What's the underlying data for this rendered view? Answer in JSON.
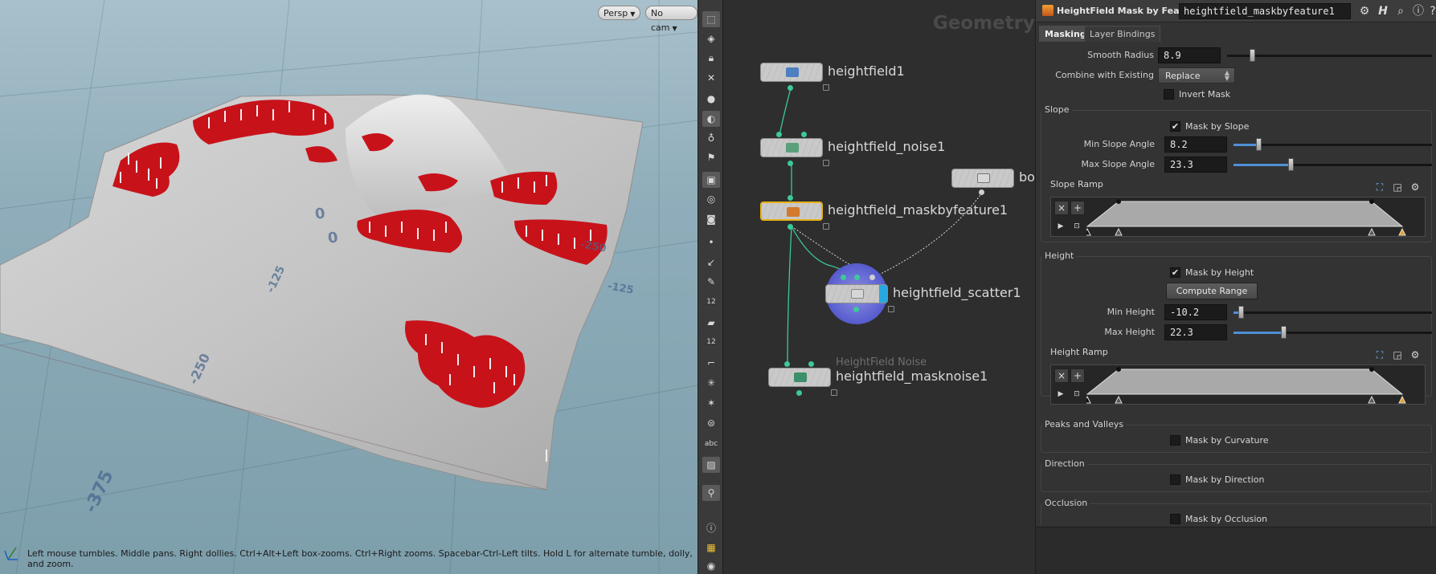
{
  "viewport": {
    "camera_view": "Persp",
    "camera": "No cam",
    "status": "Left mouse tumbles. Middle pans. Right dollies. Ctrl+Alt+Left box-zooms. Ctrl+Right zooms. Spacebar-Ctrl-Left tilts. Hold L for alternate tumble, dolly, and zoom.",
    "axis_labels": [
      "0",
      "0",
      "-125",
      "-250",
      "-375",
      "-250",
      "-125"
    ]
  },
  "shelf": {
    "tools": [
      "select-icon",
      "view-icon",
      "lock-icon",
      "pin-icon",
      "sphere-icon",
      "light-icon",
      "bulb-icon",
      "flag-icon",
      "camera-icon",
      "eye-icon",
      "camera-2-icon",
      "point-icon",
      "brush-icon",
      "pen-icon",
      "measure-icon",
      "bucket-icon",
      "stack-icon",
      "corner-icon",
      "snap-icon",
      "snap-2-icon",
      "record-icon",
      "text-icon",
      "image-icon",
      "pin-2-icon",
      "info-icon",
      "grid-icon",
      "eye-2-icon"
    ],
    "labels": {
      "measure": "12",
      "stack": "12",
      "text": "abc"
    }
  },
  "network": {
    "context": "Geometry",
    "nodes": [
      {
        "name": "heightfield1"
      },
      {
        "name": "heightfield_noise1"
      },
      {
        "name": "box:"
      },
      {
        "name": "heightfield_maskbyfeature1"
      },
      {
        "name": "heightfield_scatter1"
      },
      {
        "name": "heightfield_masknoise1",
        "subtitle": "HeightField Noise"
      }
    ]
  },
  "params": {
    "type_label": "HeightField Mask by Feature",
    "node_name": "heightfield_maskbyfeature1",
    "header_icons": [
      "gear-icon",
      "houdini-help-icon",
      "search-icon",
      "info-icon",
      "help-icon"
    ],
    "tabs": [
      "Masking",
      "Layer Bindings"
    ],
    "smooth_radius": {
      "label": "Smooth Radius",
      "value": "8.9",
      "fraction": 0.09
    },
    "combine": {
      "label": "Combine with Existing",
      "value": "Replace"
    },
    "invert_mask": {
      "label": "Invert Mask",
      "checked": false
    },
    "slope": {
      "title": "Slope",
      "mask_by_slope": {
        "label": "Mask by Slope",
        "checked": true
      },
      "min": {
        "label": "Min Slope Angle",
        "value": "8.2",
        "fraction": 0.09
      },
      "max": {
        "label": "Max Slope Angle",
        "value": "23.3",
        "fraction": 0.26
      },
      "ramp": {
        "label": "Slope Ramp"
      }
    },
    "height": {
      "title": "Height",
      "mask_by_height": {
        "label": "Mask by Height",
        "checked": true
      },
      "compute_range": "Compute Range",
      "min": {
        "label": "Min Height",
        "value": "-10.2",
        "fraction": 0.0
      },
      "max": {
        "label": "Max Height",
        "value": "22.3",
        "fraction": 0.22
      },
      "ramp": {
        "label": "Height Ramp"
      }
    },
    "peaks": {
      "title": "Peaks and Valleys",
      "option": {
        "label": "Mask by Curvature",
        "checked": false
      }
    },
    "direction": {
      "title": "Direction",
      "option": {
        "label": "Mask by Direction",
        "checked": false
      }
    },
    "occlusion": {
      "title": "Occlusion",
      "option": {
        "label": "Mask by Occlusion",
        "checked": false
      }
    },
    "ramp_buttons": {
      "remove": "×",
      "add": "+"
    }
  },
  "colors": {
    "mask_red": "#c8121a",
    "node_selected": "#e8b21a",
    "wire_green": "#3cc99a",
    "slider_blue": "#4f8fd6",
    "scatter_ring": "#5a5fd0"
  }
}
